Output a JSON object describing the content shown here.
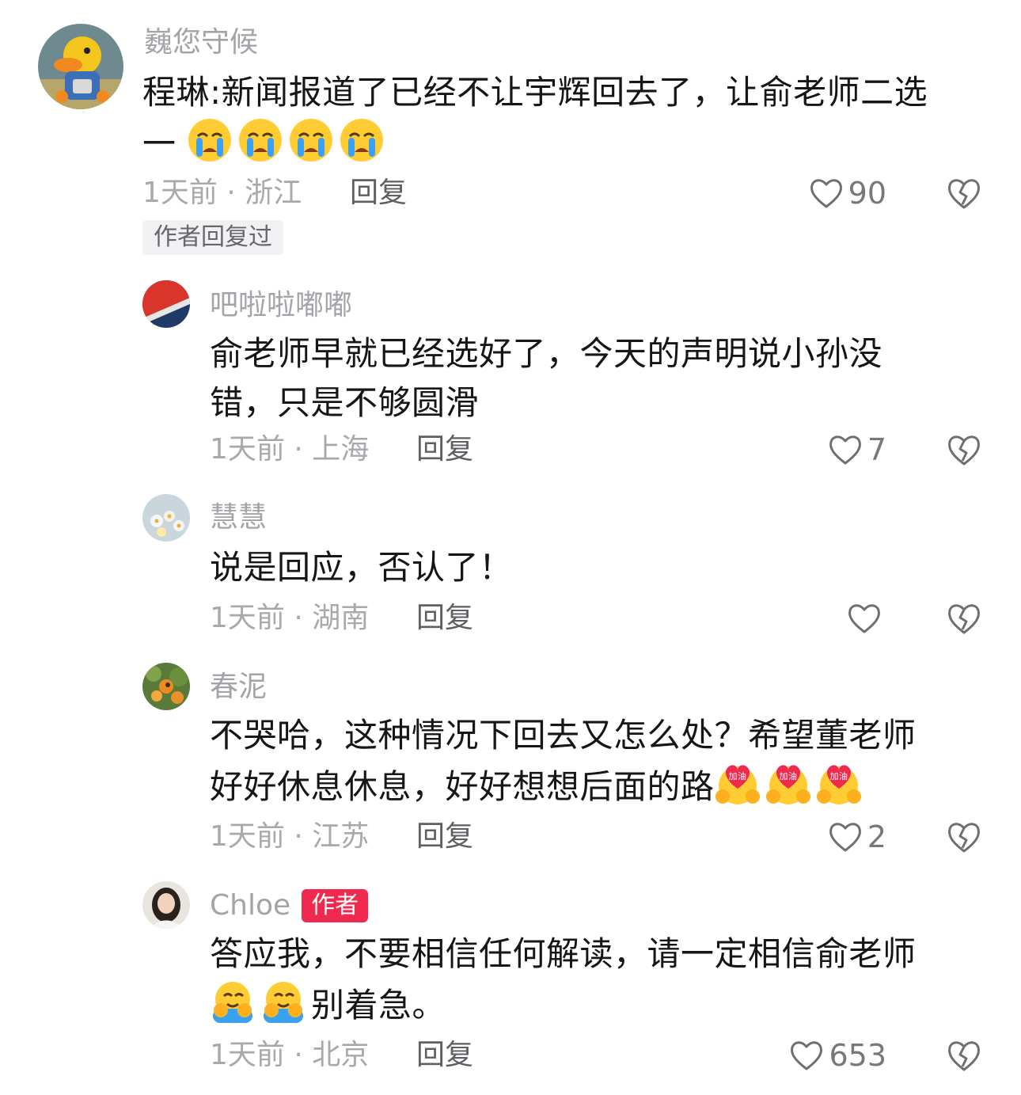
{
  "comments": [
    {
      "username": "巍您守候",
      "text_lines": [
        "程琳:新闻报道了已经不让宇辉回去了，让俞老师二选",
        "一"
      ],
      "emoji_name": "loudly-crying-face",
      "time_location": "1天前 · 浙江",
      "reply_label": "回复",
      "likes": "90",
      "replied_tag": "作者回复过"
    },
    {
      "username": "吧啦啦嘟嘟",
      "text_lines": [
        "俞老师早就已经选好了，今天的声明说小孙没",
        "错，只是不够圆滑"
      ],
      "time_location": "1天前 · 上海",
      "reply_label": "回复",
      "likes": "7"
    },
    {
      "username": "慧慧",
      "text_lines": [
        "说是回应，否认了！"
      ],
      "time_location": "1天前 · 湖南",
      "reply_label": "回复",
      "likes": ""
    },
    {
      "username": "春泥",
      "text_lines": [
        "不哭哈，这种情况下回去又怎么处？希望董老师",
        "好好休息休息，好好想想后面的路"
      ],
      "emoji_name": "jiayou-cheer-sticker",
      "emoji_text": "加油",
      "time_location": "1天前 · 江苏",
      "reply_label": "回复",
      "likes": "2"
    },
    {
      "username": "Chloe",
      "author_badge": "作者",
      "text_lines": [
        "答应我，不要相信任何解读，请一定相信俞老师",
        "别着急。"
      ],
      "emoji_name": "hugging-face",
      "time_location": "1天前 · 北京",
      "reply_label": "回复",
      "likes": "653"
    }
  ],
  "colors": {
    "username": "#a3a3a8",
    "body_text": "#161616",
    "author_badge_bg": "#f0294f",
    "meta": "#a8a8ad"
  }
}
